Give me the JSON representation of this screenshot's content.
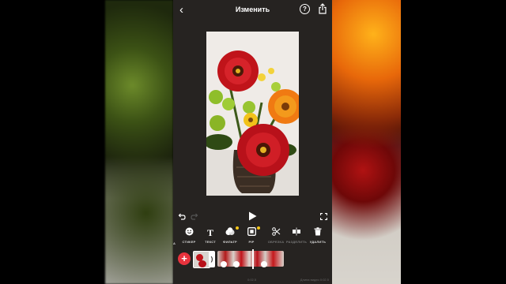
{
  "header": {
    "title": "Изменить"
  },
  "tools": [
    {
      "label": "СТИКЕР",
      "icon": "smiley-icon",
      "dim": false
    },
    {
      "label": "ТЕКСТ",
      "icon": "text-icon",
      "dim": false
    },
    {
      "label": "ФИЛЬТР",
      "icon": "filter-icon",
      "dim": false
    },
    {
      "label": "PIP",
      "icon": "pip-icon",
      "dim": false
    },
    {
      "label": "ОБРЕЗКА",
      "icon": "scissors-icon",
      "dim": true
    },
    {
      "label": "РАЗДЕЛИТЬ",
      "icon": "split-icon",
      "dim": true
    },
    {
      "label": "УДАЛИТЬ",
      "icon": "trash-icon",
      "dim": false
    }
  ],
  "partial_tool_label": "А",
  "timeline": {
    "time": "0:02.5"
  },
  "footer": {
    "left": "0:02.5",
    "right": "Длина видео 0:02.5"
  },
  "colors": {
    "app_bg": "#262321",
    "accent_red": "#e8333d",
    "badge": "#f5c518"
  }
}
